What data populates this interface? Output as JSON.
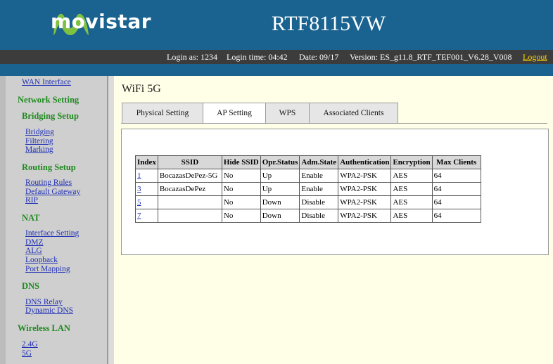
{
  "header": {
    "brand": "movistar",
    "model": "RTF8115VW",
    "login_as": "Login as: 1234",
    "login_time": "Login time: 04:42",
    "date": "Date: 09/17",
    "version": "Version: ES_g11.8_RTF_TEF001_V6.28_V008",
    "logout": "Logout"
  },
  "colors": {
    "header_bg": "#1a6391",
    "logo_green": "#7fc242",
    "section_green": "#1f8a1f",
    "link_blue": "#1f2fb5"
  },
  "sidebar": {
    "wan_interface": "WAN Interface",
    "network_setting": "Network Setting",
    "bridging_setup": "Bridging Setup",
    "bridging": "Bridging",
    "filtering": "Filtering",
    "marking": "Marking",
    "routing_setup": "Routing Setup",
    "routing_rules": "Routing Rules",
    "default_gateway": "Default Gateway",
    "rip": "RIP",
    "nat": "NAT",
    "interface_setting": "Interface Setting",
    "dmz": "DMZ",
    "alg": "ALG",
    "loopback": "Loopback",
    "port_mapping": "Port Mapping",
    "dns": "DNS",
    "dns_relay": "DNS Relay",
    "dynamic_dns": "Dynamic DNS",
    "wireless_lan": "Wireless LAN",
    "wifi_24g": "2.4G",
    "wifi_5g": "5G"
  },
  "main": {
    "title": "WiFi 5G",
    "tabs": [
      "Physical Setting",
      "AP Setting",
      "WPS",
      "Associated Clients"
    ],
    "active_tab": "AP Setting",
    "table": {
      "headers": [
        "Index",
        "SSID",
        "Hide SSID",
        "Opr.Status",
        "Adm.State",
        "Authentication",
        "Encryption",
        "Max Clients"
      ],
      "rows": [
        [
          "1",
          "BocazasDePez-5G",
          "No",
          "Up",
          "Enable",
          "WPA2-PSK",
          "AES",
          "64"
        ],
        [
          "3",
          "BocazasDePez",
          "No",
          "Up",
          "Enable",
          "WPA2-PSK",
          "AES",
          "64"
        ],
        [
          "5",
          "",
          "No",
          "Down",
          "Disable",
          "WPA2-PSK",
          "AES",
          "64"
        ],
        [
          "7",
          "",
          "No",
          "Down",
          "Disable",
          "WPA2-PSK",
          "AES",
          "64"
        ]
      ]
    }
  }
}
